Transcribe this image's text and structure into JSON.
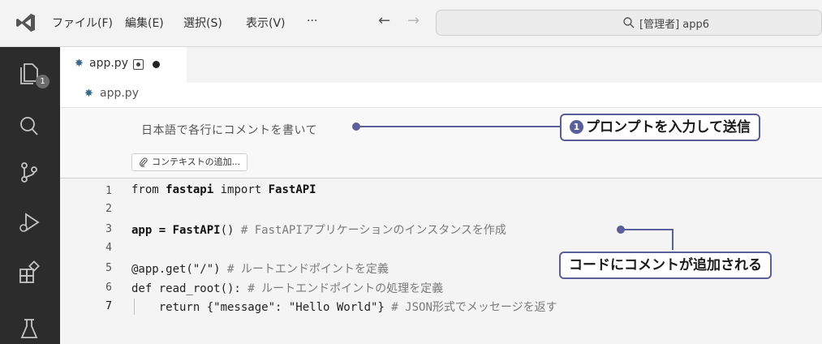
{
  "menu": {
    "file": "ファイル(F)",
    "edit": "編集(E)",
    "selection": "選択(S)",
    "view": "表示(V)",
    "more": "···"
  },
  "nav": {
    "back": "←",
    "forward": "→"
  },
  "search": {
    "label": "[管理者] app6"
  },
  "activity": {
    "explorer_badge": "1"
  },
  "tab": {
    "filename": "app.py"
  },
  "breadcrumb": {
    "filename": "app.py"
  },
  "prompt": {
    "text": "日本語で各行にコメントを書いて",
    "context_button": "コンテキストの追加..."
  },
  "code": {
    "line_numbers": [
      "1",
      "2",
      "3",
      "4",
      "5",
      "6",
      "7"
    ],
    "line1": {
      "kw": "from ",
      "mod": "fastapi",
      "kw2": " import ",
      "cls": "FastAPI"
    },
    "line3": {
      "a": "app = ",
      "b": "FastAPI",
      "c": "() ",
      "comment": "# FastAPIアプリケーションのインスタンスを作成"
    },
    "line5": {
      "a": "@app.get(\"/\") ",
      "comment": "# ルートエンドポイントを定義"
    },
    "line6": {
      "a": "def read_root(): ",
      "comment": "# ルートエンドポイントの処理を定義"
    },
    "line7": {
      "a": "    return {\"message\": \"Hello World\"} ",
      "comment": "# JSON形式でメッセージを返す"
    }
  },
  "callouts": {
    "step1_num": "1",
    "step1": "プロンプトを入力して送信",
    "step2": "コードにコメントが追加される"
  },
  "colors": {
    "activitybar": "#2c2c2c",
    "callout_border": "#5a5e99"
  },
  "icons": {
    "logo": "vscode-logo-icon",
    "explorer": "files-icon",
    "search": "search-icon",
    "scm": "source-control-icon",
    "debug": "run-debug-icon",
    "extensions": "extensions-icon",
    "testing": "testing-icon",
    "python": "python-file-icon",
    "context": "paperclip-icon"
  }
}
